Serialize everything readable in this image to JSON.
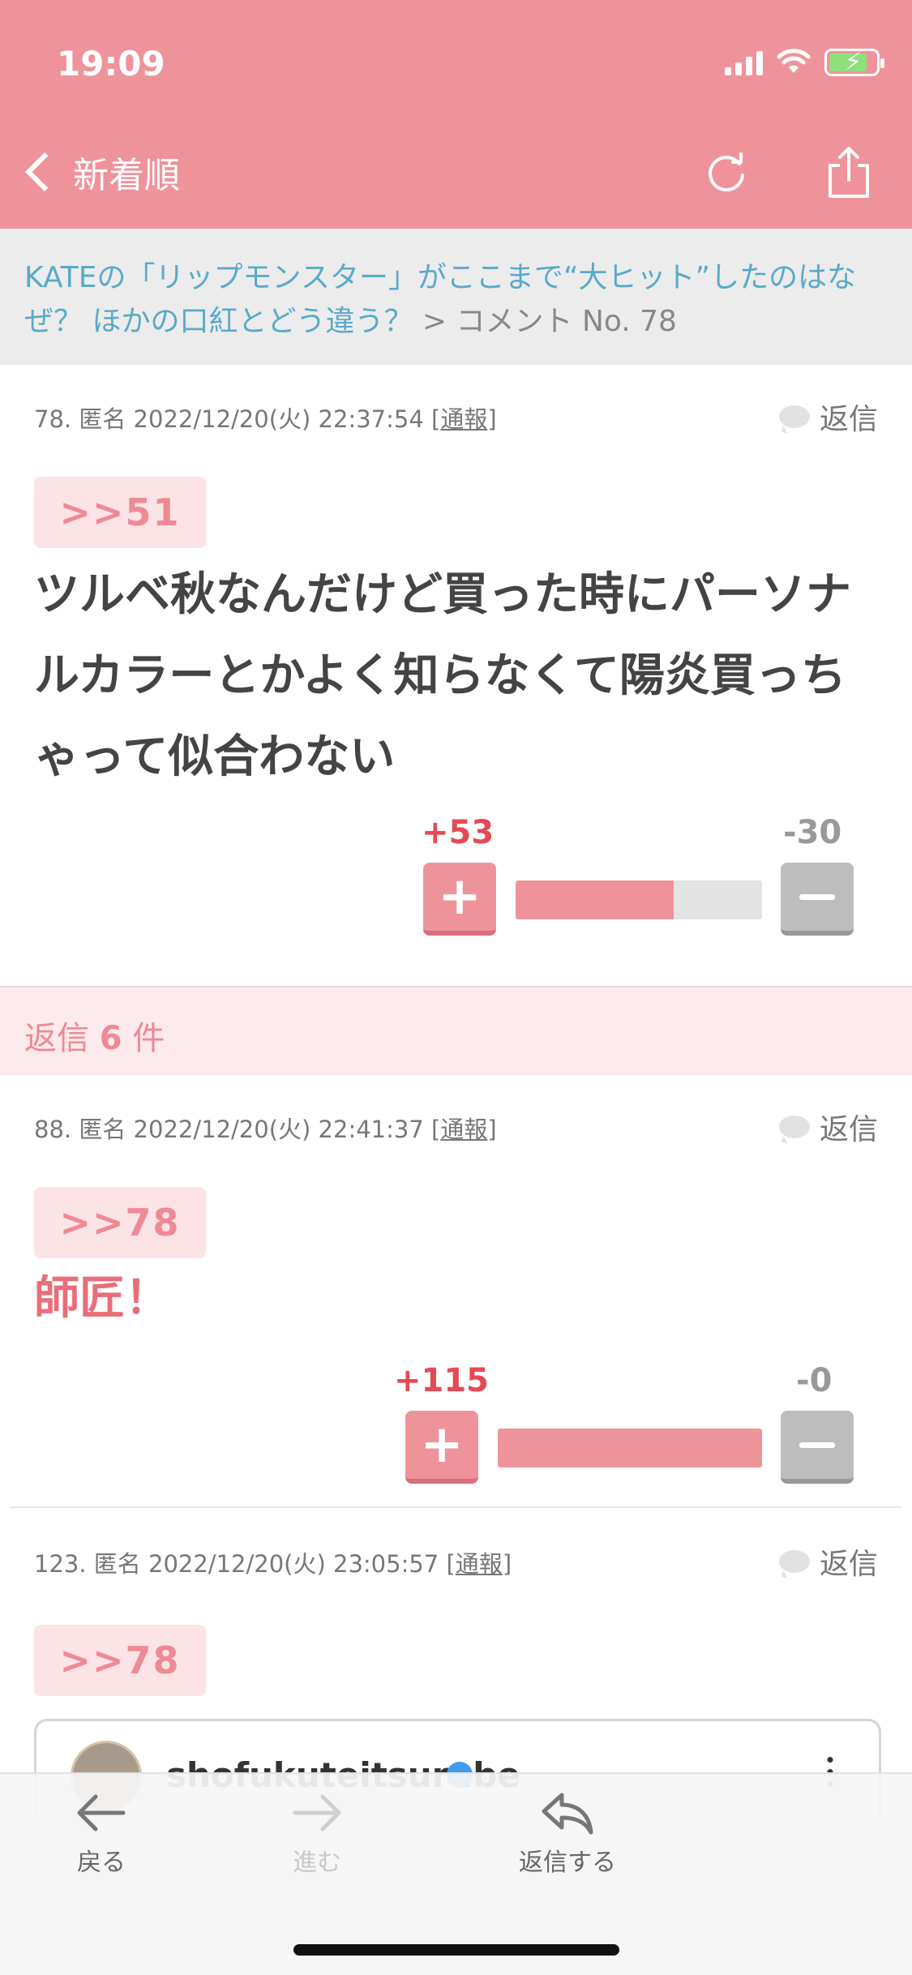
{
  "status": {
    "time": "19:09"
  },
  "nav": {
    "back_label": "新着順",
    "reload_icon": "reload-icon",
    "share_icon": "share-icon"
  },
  "breadcrumb": {
    "link_text": "KATEの「リップモンスター」がここまで“大ヒット”したのはなぜ？ ほかの口紅とどう違う？",
    "suffix": " > コメント No. 78"
  },
  "comments": [
    {
      "meta": "78. 匿名 2022/12/20(火) 22:37:54",
      "report": "通報",
      "reply_label": "返信",
      "anchor": ">>51",
      "body": "ツルベ秋なんだけど買った時にパーソナルカラーとかよく知らなくて陽炎買っちゃって似合わない",
      "plus": "+53",
      "minus": "-30",
      "plus_ratio": 0.64
    },
    {
      "meta": "88. 匿名 2022/12/20(火) 22:41:37",
      "report": "通報",
      "reply_label": "返信",
      "anchor": ">>78",
      "body": "師匠！",
      "plus": "+115",
      "minus": "-0",
      "plus_ratio": 1.0
    },
    {
      "meta": "123. 匿名 2022/12/20(火) 23:05:57",
      "report": "通報",
      "reply_label": "返信",
      "anchor": ">>78",
      "embed_user": "shofukuteitsurube"
    }
  ],
  "replies": {
    "prefix": "返信",
    "count": "6",
    "suffix": "件"
  },
  "bottom_nav": {
    "back": "戻る",
    "forward": "進む",
    "reply": "返信する"
  },
  "colors": {
    "brand_pink": "#ef939a",
    "plus_red": "#e44a55",
    "link_blue": "#5aaac8"
  }
}
